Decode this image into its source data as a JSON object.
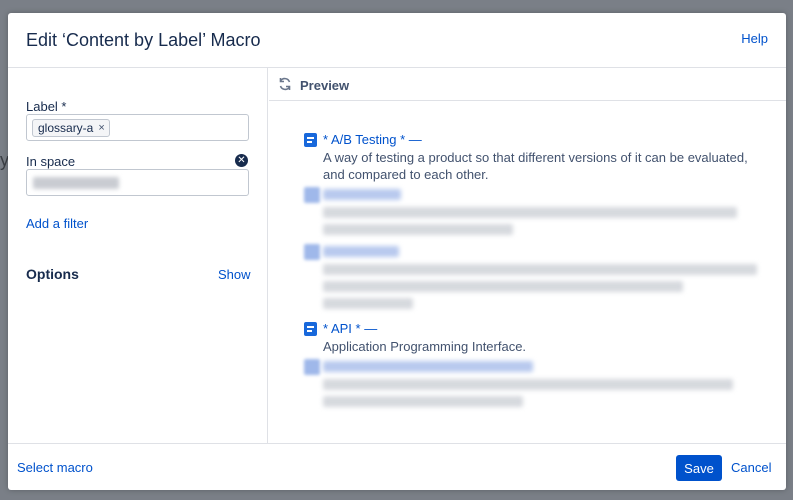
{
  "backdrop": {
    "text": "y"
  },
  "dialog": {
    "title": "Edit ‘Content by Label’ Macro",
    "help_label": "Help"
  },
  "left": {
    "label_field_label": "Label *",
    "label_chip": "glossary-a",
    "chip_remove": "×",
    "space_field_label": "In space",
    "clear_icon_glyph": "✕",
    "add_filter_label": "Add a filter",
    "options_label": "Options",
    "show_label": "Show"
  },
  "preview": {
    "title": "Preview",
    "entries": [
      {
        "title": "* A/B Testing * —",
        "description": "A way of testing a product so that different versions of it can be evaluated, and compared to each other."
      },
      {
        "title": "* API * —",
        "description": "Application Programming Interface."
      }
    ]
  },
  "footer": {
    "select_macro_label": "Select macro",
    "save_label": "Save",
    "cancel_label": "Cancel"
  },
  "icons": {
    "refresh": "refresh-icon",
    "page": "page-icon",
    "clear": "clear-icon"
  },
  "colors": {
    "accent": "#0052cc",
    "page_icon": "#1868db",
    "text": "#172b4d",
    "backdrop": "#7a7f87"
  }
}
